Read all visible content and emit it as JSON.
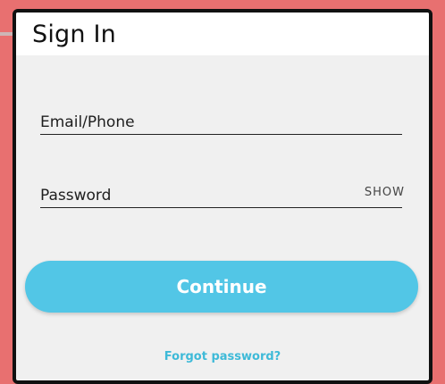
{
  "header": {
    "title": "Sign In"
  },
  "form": {
    "email_label": "Email/Phone",
    "password_label": "Password",
    "show_toggle": "SHOW",
    "continue_label": "Continue",
    "forgot_label": "Forgot password?"
  },
  "colors": {
    "page_background": "#e87070",
    "card_background": "#f0f0f0",
    "header_background": "#ffffff",
    "button_accent": "#52c6e6",
    "link_color": "#3ebad8"
  }
}
